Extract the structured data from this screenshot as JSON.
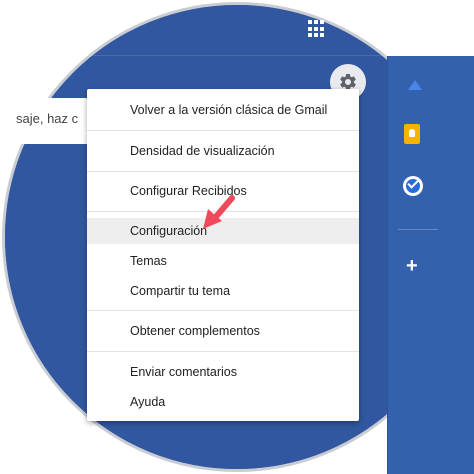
{
  "search": {
    "text": "saje, haz c"
  },
  "menu": {
    "items": [
      {
        "label": "Volver a la versión clásica de Gmail"
      },
      {
        "label": "Densidad de visualización"
      },
      {
        "label": "Configurar Recibidos"
      },
      {
        "label": "Configuración"
      },
      {
        "label": "Temas"
      },
      {
        "label": "Compartir tu tema"
      },
      {
        "label": "Obtener complementos"
      },
      {
        "label": "Enviar comentarios"
      },
      {
        "label": "Ayuda"
      }
    ]
  },
  "colors": {
    "background": "#3157a0",
    "menu": "#ffffff",
    "highlight": "#eeeeee",
    "arrow": "#f04a5a"
  },
  "icons": [
    "apps-grid-icon",
    "gear-icon",
    "keep-icon",
    "tasks-icon",
    "add-icon",
    "pointer-arrow-icon"
  ]
}
